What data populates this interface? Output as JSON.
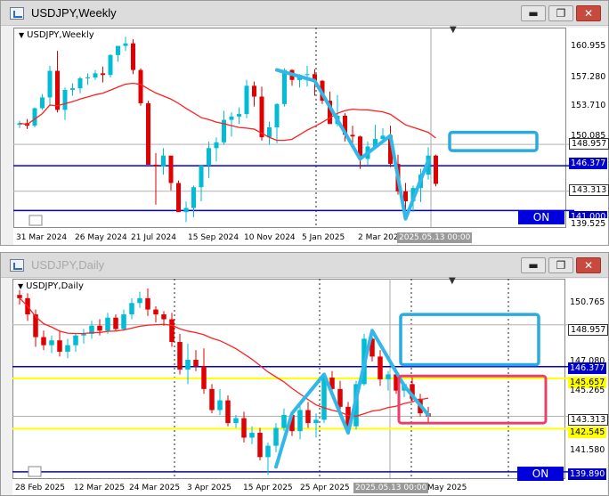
{
  "colors": {
    "bull": "#00bcd4",
    "bear": "#e00000",
    "ma": "#ff2020",
    "blue_level": "#0000dd",
    "yellow_level": "#ffff00",
    "zone_box": "#29abe2",
    "pink_box": "#e8406a",
    "trend_line": "#31b7e8"
  },
  "weekly": {
    "title": "USDJPY,Weekly",
    "chart_label": "USDJPY,Weekly",
    "buttons": {
      "minimize": "▬",
      "restore": "❐",
      "close": "✕"
    },
    "scale_mark": "▼",
    "price_labels": [
      "160.955",
      "157.280",
      "153.710",
      "150.085",
      "148.957",
      "146.377",
      "143.313",
      "141.000",
      "139.525"
    ],
    "time_labels": [
      "31 Mar 2024",
      "26 May 2024",
      "21 Jul 2024",
      "15 Sep 2024",
      "10 Nov 2024",
      "5 Jan 2025",
      "2 Mar 202"
    ],
    "cursor_date": "2025.05.13 00:00",
    "on_label": "ON",
    "chart_data": {
      "type": "candlestick",
      "symbol": "USDJPY",
      "timeframe": "Weekly",
      "ylim": [
        139.0,
        163.0
      ],
      "levels": {
        "gray_upper": 148.957,
        "blue_upper": 146.377,
        "gray_lower": 143.313,
        "blue_lower": 141.0
      },
      "zone_box": [
        148.2,
        150.4
      ],
      "ohlc": [
        [
          151.3,
          151.8,
          150.9,
          151.5
        ],
        [
          151.5,
          152.0,
          150.8,
          151.2
        ],
        [
          151.2,
          153.4,
          151.0,
          153.3
        ],
        [
          153.3,
          155.0,
          153.1,
          154.6
        ],
        [
          154.6,
          158.4,
          153.6,
          157.8
        ],
        [
          157.8,
          160.2,
          152.8,
          153.1
        ],
        [
          153.1,
          155.8,
          151.9,
          155.5
        ],
        [
          155.5,
          156.3,
          154.8,
          155.7
        ],
        [
          155.7,
          157.1,
          155.1,
          156.9
        ],
        [
          156.9,
          157.5,
          156.1,
          157.0
        ],
        [
          157.0,
          157.9,
          156.7,
          157.5
        ],
        [
          157.5,
          158.3,
          156.4,
          157.3
        ],
        [
          157.3,
          159.8,
          157.0,
          159.7
        ],
        [
          159.7,
          160.6,
          158.9,
          160.8
        ],
        [
          160.8,
          161.9,
          160.2,
          161.1
        ],
        [
          161.1,
          161.6,
          157.4,
          157.9
        ],
        [
          157.9,
          158.1,
          153.6,
          153.9
        ],
        [
          153.9,
          154.2,
          146.6,
          146.5
        ],
        [
          146.5,
          147.9,
          141.7,
          146.3
        ],
        [
          146.3,
          148.5,
          145.3,
          147.6
        ],
        [
          147.6,
          147.3,
          143.4,
          144.3
        ],
        [
          144.3,
          144.6,
          140.9,
          140.8
        ],
        [
          140.8,
          142.1,
          139.6,
          141.3
        ],
        [
          141.3,
          144.0,
          140.2,
          143.8
        ],
        [
          143.8,
          146.4,
          142.1,
          146.4
        ],
        [
          146.4,
          149.3,
          144.9,
          148.5
        ],
        [
          148.5,
          149.8,
          146.9,
          149.2
        ],
        [
          149.2,
          153.0,
          148.9,
          151.9
        ],
        [
          151.9,
          152.8,
          149.9,
          152.3
        ],
        [
          152.3,
          153.4,
          151.4,
          152.6
        ],
        [
          152.6,
          156.7,
          152.1,
          156.0
        ],
        [
          156.0,
          156.5,
          153.5,
          154.7
        ],
        [
          154.7,
          155.9,
          149.4,
          149.8
        ],
        [
          149.8,
          151.7,
          148.9,
          151.0
        ],
        [
          151.0,
          153.9,
          149.1,
          153.8
        ],
        [
          153.8,
          158.1,
          153.5,
          157.9
        ],
        [
          157.9,
          158.0,
          156.0,
          156.7
        ],
        [
          156.7,
          157.4,
          155.8,
          157.3
        ],
        [
          157.3,
          158.4,
          155.9,
          157.4
        ],
        [
          157.4,
          158.0,
          154.8,
          156.6
        ],
        [
          156.6,
          156.7,
          153.8,
          154.2
        ],
        [
          154.2,
          155.3,
          151.6,
          151.4
        ],
        [
          151.4,
          154.9,
          151.1,
          152.4
        ],
        [
          152.4,
          152.7,
          149.3,
          150.1
        ],
        [
          150.1,
          151.2,
          149.1,
          149.9
        ],
        [
          149.9,
          150.0,
          146.0,
          147.2
        ],
        [
          147.2,
          149.3,
          146.5,
          148.7
        ],
        [
          148.7,
          151.3,
          148.5,
          149.6
        ],
        [
          149.6,
          150.9,
          149.1,
          150.0
        ],
        [
          150.0,
          151.2,
          146.2,
          146.6
        ],
        [
          146.6,
          147.7,
          142.9,
          143.3
        ],
        [
          143.3,
          144.3,
          139.9,
          142.1
        ],
        [
          142.1,
          144.0,
          140.8,
          143.7
        ],
        [
          143.7,
          146.0,
          142.0,
          145.3
        ],
        [
          145.3,
          148.6,
          144.7,
          147.6
        ],
        [
          147.6,
          147.7,
          143.9,
          144.2
        ]
      ]
    }
  },
  "daily": {
    "title": "USDJPY,Daily",
    "chart_label": "USDJPY,Daily",
    "buttons": {
      "minimize": "▬",
      "restore": "❐",
      "close": "✕"
    },
    "scale_mark": "▼",
    "price_labels": [
      "150.765",
      "148.957",
      "147.080",
      "146.377",
      "145.657",
      "145.265",
      "143.313",
      "142.545",
      "141.580",
      "139.890"
    ],
    "time_labels": [
      "28 Feb 2025",
      "12 Mar 2025",
      "24 Mar 2025",
      "3 Apr 2025",
      "15 Apr 2025",
      "25 Apr 2025",
      "May 2025"
    ],
    "cursor_date": "2025.05.13 00:00",
    "on_label": "ON",
    "chart_data": {
      "type": "candlestick",
      "symbol": "USDJPY",
      "timeframe": "Daily",
      "ylim": [
        139.5,
        151.8
      ],
      "levels": {
        "gray_upper": 148.957,
        "blue_upper": 146.377,
        "yellow_upper": 145.657,
        "gray_lower": 143.313,
        "yellow_lower": 142.545,
        "blue_lower": 139.89
      },
      "zone_box": [
        146.5,
        149.6
      ],
      "pink_box": [
        142.9,
        145.8
      ],
      "ohlc": [
        [
          150.8,
          151.1,
          150.2,
          150.6
        ],
        [
          150.6,
          150.9,
          149.2,
          149.6
        ],
        [
          149.6,
          149.9,
          147.6,
          148.2
        ],
        [
          148.2,
          148.6,
          147.4,
          147.7
        ],
        [
          147.7,
          148.3,
          147.2,
          148.0
        ],
        [
          148.0,
          148.6,
          147.0,
          147.3
        ],
        [
          147.3,
          148.1,
          146.9,
          147.7
        ],
        [
          147.7,
          148.4,
          147.3,
          148.3
        ],
        [
          148.3,
          148.7,
          147.8,
          148.4
        ],
        [
          148.4,
          149.2,
          148.1,
          148.9
        ],
        [
          148.9,
          149.3,
          148.3,
          148.6
        ],
        [
          148.6,
          149.7,
          148.4,
          149.4
        ],
        [
          149.4,
          149.6,
          148.6,
          148.7
        ],
        [
          148.7,
          149.9,
          148.6,
          149.6
        ],
        [
          149.6,
          150.6,
          149.3,
          150.3
        ],
        [
          150.3,
          151.0,
          150.0,
          150.6
        ],
        [
          150.6,
          151.2,
          149.5,
          149.9
        ],
        [
          149.9,
          150.1,
          149.1,
          149.6
        ],
        [
          149.6,
          149.8,
          148.9,
          149.3
        ],
        [
          149.3,
          149.7,
          147.6,
          147.9
        ],
        [
          147.9,
          148.4,
          145.9,
          146.2
        ],
        [
          146.2,
          147.8,
          145.3,
          146.8
        ],
        [
          146.8,
          147.4,
          146.1,
          146.4
        ],
        [
          146.4,
          147.5,
          144.7,
          145.0
        ],
        [
          145.0,
          145.3,
          143.5,
          143.7
        ],
        [
          143.7,
          145.0,
          143.4,
          144.3
        ],
        [
          144.3,
          144.6,
          142.7,
          142.9
        ],
        [
          142.9,
          143.4,
          142.6,
          143.2
        ],
        [
          143.2,
          143.6,
          141.7,
          142.0
        ],
        [
          142.0,
          142.7,
          141.6,
          142.3
        ],
        [
          142.3,
          142.6,
          140.6,
          140.8
        ],
        [
          140.8,
          141.7,
          139.7,
          141.5
        ],
        [
          141.5,
          142.9,
          141.1,
          142.6
        ],
        [
          142.6,
          143.8,
          142.4,
          143.4
        ],
        [
          143.4,
          143.6,
          142.1,
          142.4
        ],
        [
          142.4,
          144.0,
          141.9,
          143.7
        ],
        [
          143.7,
          144.2,
          142.6,
          142.9
        ],
        [
          142.9,
          143.5,
          142.0,
          143.1
        ],
        [
          143.1,
          145.9,
          142.9,
          145.7
        ],
        [
          145.7,
          146.1,
          144.8,
          145.0
        ],
        [
          145.0,
          145.5,
          143.6,
          143.9
        ],
        [
          143.9,
          144.2,
          142.5,
          142.7
        ],
        [
          142.7,
          145.5,
          142.5,
          145.3
        ],
        [
          145.3,
          148.4,
          145.2,
          148.1
        ],
        [
          148.1,
          148.6,
          146.7,
          147.0
        ],
        [
          147.0,
          147.4,
          145.2,
          145.6
        ],
        [
          145.6,
          146.1,
          144.9,
          145.9
        ],
        [
          145.9,
          146.2,
          144.7,
          144.9
        ],
        [
          144.9,
          145.4,
          144.5,
          145.3
        ],
        [
          145.3,
          145.7,
          144.2,
          144.4
        ],
        [
          144.4,
          144.7,
          143.3,
          143.5
        ],
        [
          143.5,
          143.9,
          142.9,
          143.3
        ]
      ]
    }
  }
}
